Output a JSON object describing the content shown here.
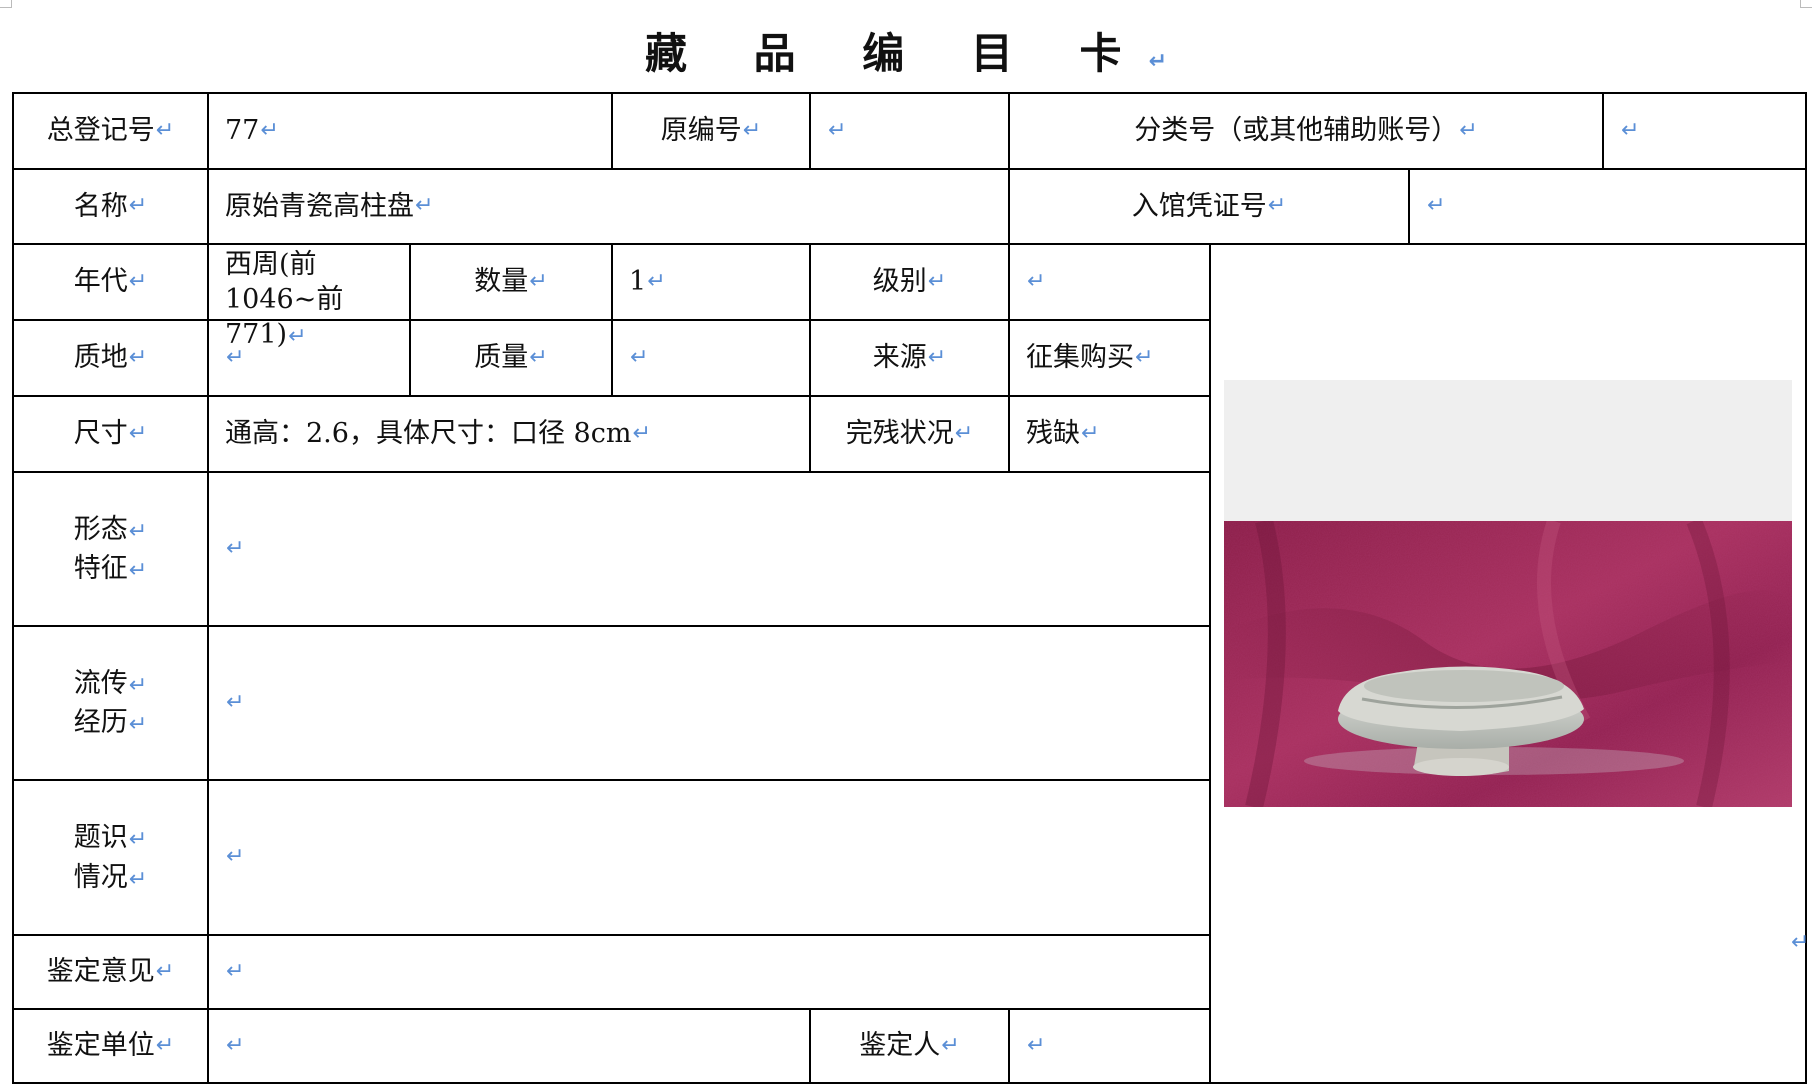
{
  "title": "藏 品 编 目 卡",
  "paragraph_mark": "↵",
  "row1": {
    "reg_label": "总登记号",
    "reg_value": "77",
    "orig_label": "原编号",
    "orig_value": "",
    "class_label": "分类号（或其他辅助账号）",
    "class_value": ""
  },
  "row2": {
    "name_label": "名称",
    "name_value": "原始青瓷高柱盘",
    "voucher_label": "入馆凭证号",
    "voucher_value": ""
  },
  "row3": {
    "era_label": "年代",
    "era_line1": "西周(前",
    "era_line2": "1046~前 771)",
    "qty_label": "数量",
    "qty_value": "1",
    "grade_label": "级别",
    "grade_value": ""
  },
  "row4": {
    "material_label": "质地",
    "material_value": "",
    "weight_label": "质量",
    "weight_value": "",
    "source_label": "来源",
    "source_value": "征集购买"
  },
  "row5": {
    "size_label": "尺寸",
    "size_value": "通高：2.6，具体尺寸：口径 8cm",
    "cond_label": "完残状况",
    "cond_value": "残缺"
  },
  "row6": {
    "label_line1": "形态",
    "label_line2": "特征",
    "value": ""
  },
  "row7": {
    "label_line1": "流传",
    "label_line2": "经历",
    "value": ""
  },
  "row8": {
    "label_line1": "题识",
    "label_line2": "情况",
    "value": ""
  },
  "row9": {
    "label": "鉴定意见",
    "value": ""
  },
  "row10": {
    "label": "鉴定单位",
    "value": "",
    "person_label": "鉴定人",
    "person_value": ""
  },
  "photo": {
    "subject": "original celadon high-stem dish on red velvet"
  },
  "colors": {
    "paragraph_mark": "#5b8fd6",
    "velvet": "#9c2452",
    "photo_bg": "#efefef",
    "line": "#000000"
  }
}
